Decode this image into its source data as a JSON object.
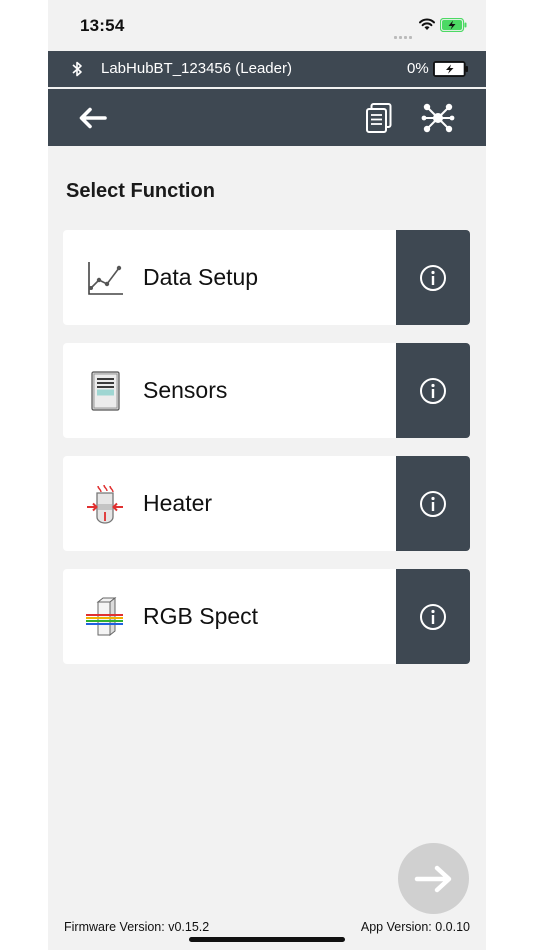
{
  "status_bar": {
    "time": "13:54"
  },
  "connection": {
    "device_name": "LabHubBT_123456 (Leader)",
    "battery_percent": "0%"
  },
  "toolbar": {
    "back_icon": "arrow-left-icon",
    "copy_icon": "copy-documents-icon",
    "network_icon": "network-hub-icon"
  },
  "main": {
    "section_title": "Select Function",
    "functions": [
      {
        "label": "Data Setup",
        "icon": "line-chart-icon"
      },
      {
        "label": "Sensors",
        "icon": "sensor-module-icon"
      },
      {
        "label": "Heater",
        "icon": "heater-icon"
      },
      {
        "label": "RGB Spect",
        "icon": "rgb-spectrometer-icon"
      }
    ],
    "info_icon": "info-icon"
  },
  "footer": {
    "firmware_version": "Firmware Version: v0.15.2",
    "app_version": "App Version: 0.0.10"
  },
  "colors": {
    "header_bg": "#3e4852",
    "page_bg": "#f2f2f2",
    "card_bg": "#ffffff",
    "next_button_bg": "#d0d0d0",
    "battery_green": "#4cd964"
  }
}
